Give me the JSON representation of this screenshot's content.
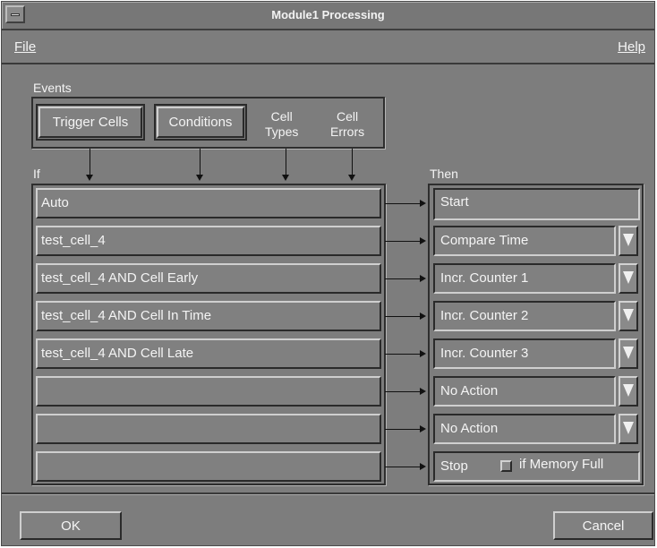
{
  "window": {
    "title": "Module1 Processing"
  },
  "menu": {
    "file": "File",
    "help": "Help"
  },
  "events": {
    "label": "Events",
    "trigger_cells": "Trigger Cells",
    "conditions": "Conditions",
    "cell_types_line1": "Cell",
    "cell_types_line2": "Types",
    "cell_errors_line1": "Cell",
    "cell_errors_line2": "Errors"
  },
  "if_label": "If",
  "then_label": "Then",
  "conditions_rows": [
    "Auto",
    "test_cell_4",
    "test_cell_4 AND Cell Early",
    "test_cell_4 AND Cell In Time",
    "test_cell_4 AND Cell Late",
    "",
    "",
    ""
  ],
  "actions": [
    "Start",
    "Compare Time",
    "Incr. Counter 1",
    "Incr. Counter 2",
    "Incr. Counter 3",
    "No Action",
    "No Action",
    "Stop"
  ],
  "stop_option": {
    "label": "if Memory Full",
    "checked": false
  },
  "footer": {
    "ok": "OK",
    "cancel": "Cancel"
  },
  "icons": {
    "dropdown": "dropdown-arrow-icon",
    "system_menu": "system-menu-icon"
  }
}
